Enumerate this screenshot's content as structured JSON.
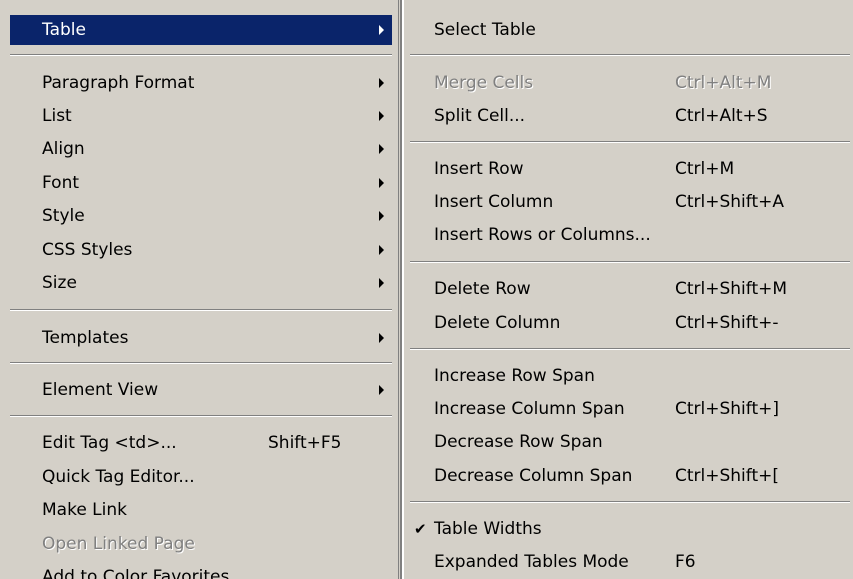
{
  "left_menu": {
    "items": [
      {
        "label": "Table"
      },
      {
        "label": "Paragraph Format"
      },
      {
        "label": "List"
      },
      {
        "label": "Align"
      },
      {
        "label": "Font"
      },
      {
        "label": "Style"
      },
      {
        "label": "CSS Styles"
      },
      {
        "label": "Size"
      },
      {
        "label": "Templates"
      },
      {
        "label": "Element View"
      },
      {
        "label": "Edit Tag <td>...",
        "shortcut": "Shift+F5"
      },
      {
        "label": "Quick Tag Editor..."
      },
      {
        "label": "Make Link"
      },
      {
        "label": "Open Linked Page"
      },
      {
        "label": "Add to Color Favorites"
      }
    ]
  },
  "right_menu": {
    "items": [
      {
        "label": "Select Table"
      },
      {
        "label": "Merge Cells",
        "shortcut": "Ctrl+Alt+M"
      },
      {
        "label": "Split Cell...",
        "shortcut": "Ctrl+Alt+S"
      },
      {
        "label": "Insert Row",
        "shortcut": "Ctrl+M"
      },
      {
        "label": "Insert Column",
        "shortcut": "Ctrl+Shift+A"
      },
      {
        "label": "Insert Rows or Columns..."
      },
      {
        "label": "Delete Row",
        "shortcut": "Ctrl+Shift+M"
      },
      {
        "label": "Delete Column",
        "shortcut": "Ctrl+Shift+-"
      },
      {
        "label": "Increase Row Span"
      },
      {
        "label": "Increase Column Span",
        "shortcut": "Ctrl+Shift+]"
      },
      {
        "label": "Decrease Row Span"
      },
      {
        "label": "Decrease Column Span",
        "shortcut": "Ctrl+Shift+["
      },
      {
        "label": "Table Widths",
        "check": "✔"
      },
      {
        "label": "Expanded Tables Mode",
        "shortcut": "F6"
      }
    ]
  },
  "colors": {
    "menu_bg": "#d4d0c8",
    "highlight_bg": "#0a246a",
    "highlight_text": "#ffffff",
    "disabled_text": "#808080"
  }
}
